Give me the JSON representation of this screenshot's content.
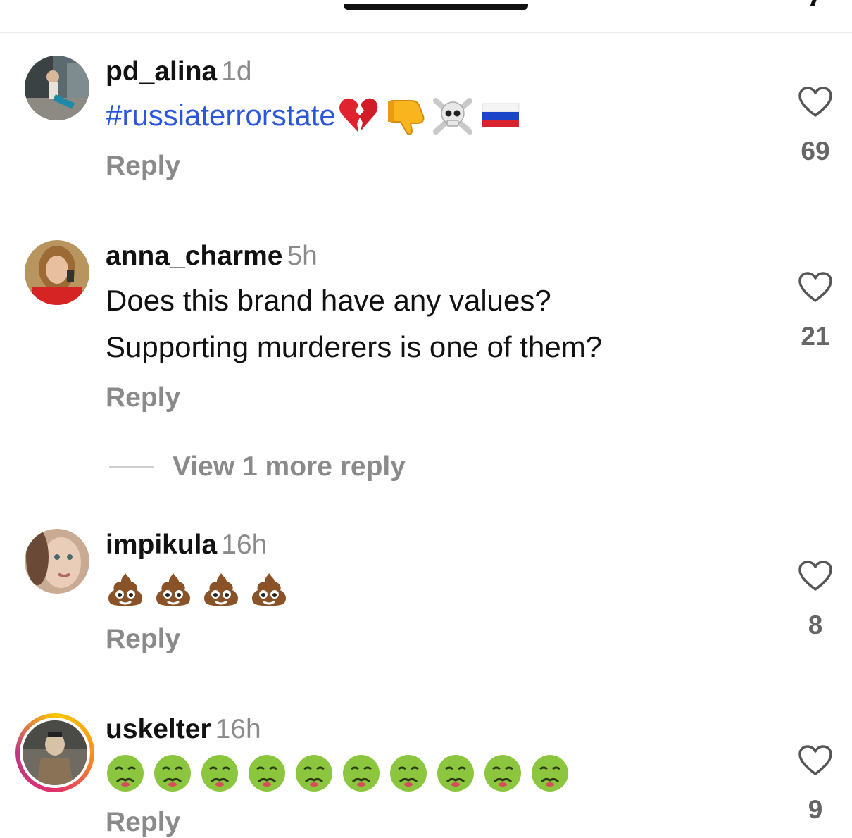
{
  "colors": {
    "hashtag": "#2b56d8",
    "muted": "#8a8a8a",
    "text": "#111111"
  },
  "comments": [
    {
      "username": "pd_alina",
      "time": "1d",
      "text": "#russiaterrorstate",
      "emojis": [
        "broken-heart",
        "thumbs-down",
        "skull-crossbones",
        "russia-flag"
      ],
      "reply": "Reply",
      "likes": "69"
    },
    {
      "username": "anna_charme",
      "time": "5h",
      "lines": [
        "Does this brand have any values?",
        "Supporting murderers is one of them?"
      ],
      "reply": "Reply",
      "likes": "21",
      "view_more": "View 1 more reply"
    },
    {
      "username": "impikula",
      "time": "16h",
      "emojis": [
        "pile-of-poo",
        "pile-of-poo",
        "pile-of-poo",
        "pile-of-poo"
      ],
      "reply": "Reply",
      "likes": "8"
    },
    {
      "username": "uskelter",
      "time": "16h",
      "emojis": [
        "nauseated-face",
        "nauseated-face",
        "nauseated-face",
        "nauseated-face",
        "nauseated-face",
        "nauseated-face",
        "nauseated-face",
        "nauseated-face",
        "nauseated-face",
        "nauseated-face"
      ],
      "reply": "Reply",
      "likes": "9"
    }
  ]
}
